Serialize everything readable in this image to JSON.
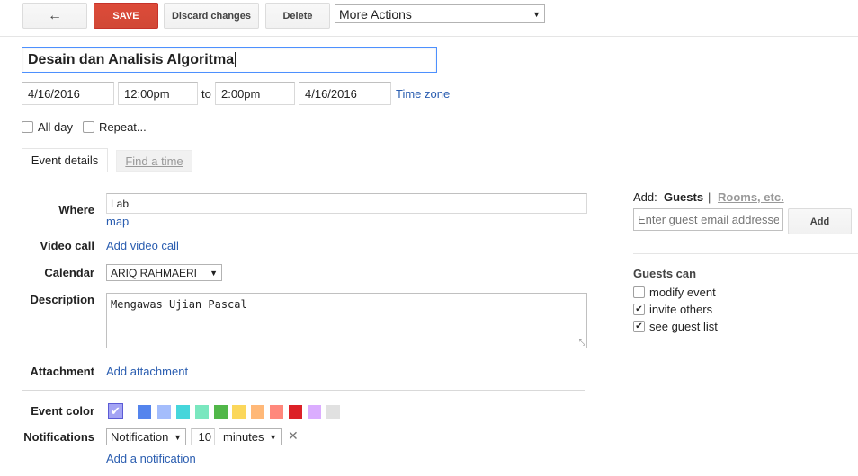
{
  "toolbar": {
    "back_icon": "back-arrow-icon",
    "save_label": "SAVE",
    "discard_label": "Discard changes",
    "delete_label": "Delete",
    "more_actions_label": "More Actions"
  },
  "event": {
    "title": "Desain dan Analisis Algoritma",
    "start_date": "4/16/2016",
    "start_time": "12:00pm",
    "to_label": "to",
    "end_time": "2:00pm",
    "end_date": "4/16/2016",
    "timezone_label": "Time zone",
    "all_day_label": "All day",
    "repeat_label": "Repeat..."
  },
  "tabs": {
    "event_details": "Event details",
    "find_a_time": "Find a time"
  },
  "details": {
    "where_label": "Where",
    "where_value": "Lab",
    "map_link": "map",
    "video_call_label": "Video call",
    "add_video_call": "Add video call",
    "calendar_label": "Calendar",
    "calendar_value": "ARIQ RAHMAERI",
    "description_label": "Description",
    "description_value": "Mengawas Ujian Pascal",
    "attachment_label": "Attachment",
    "add_attachment": "Add attachment",
    "event_color_label": "Event color",
    "notifications_label": "Notifications",
    "notification_type": "Notification",
    "notification_amount": "10",
    "notification_unit": "minutes",
    "add_notification": "Add a notification"
  },
  "colors": {
    "swatches": [
      "#5484ed",
      "#a4bdfc",
      "#46d6db",
      "#7ae7bf",
      "#51b749",
      "#fbd75b",
      "#ffb878",
      "#ff887c",
      "#dc2127",
      "#dbadff",
      "#e1e1e1"
    ],
    "selected": "#a4a4f4"
  },
  "guests": {
    "add_label": "Add:",
    "guests_tab": "Guests",
    "separator": "|",
    "rooms_tab": "Rooms, etc.",
    "email_placeholder": "Enter guest email addresses",
    "add_button": "Add",
    "guests_can_label": "Guests can",
    "modify_event": "modify event",
    "invite_others": "invite others",
    "see_guest_list": "see guest list"
  }
}
